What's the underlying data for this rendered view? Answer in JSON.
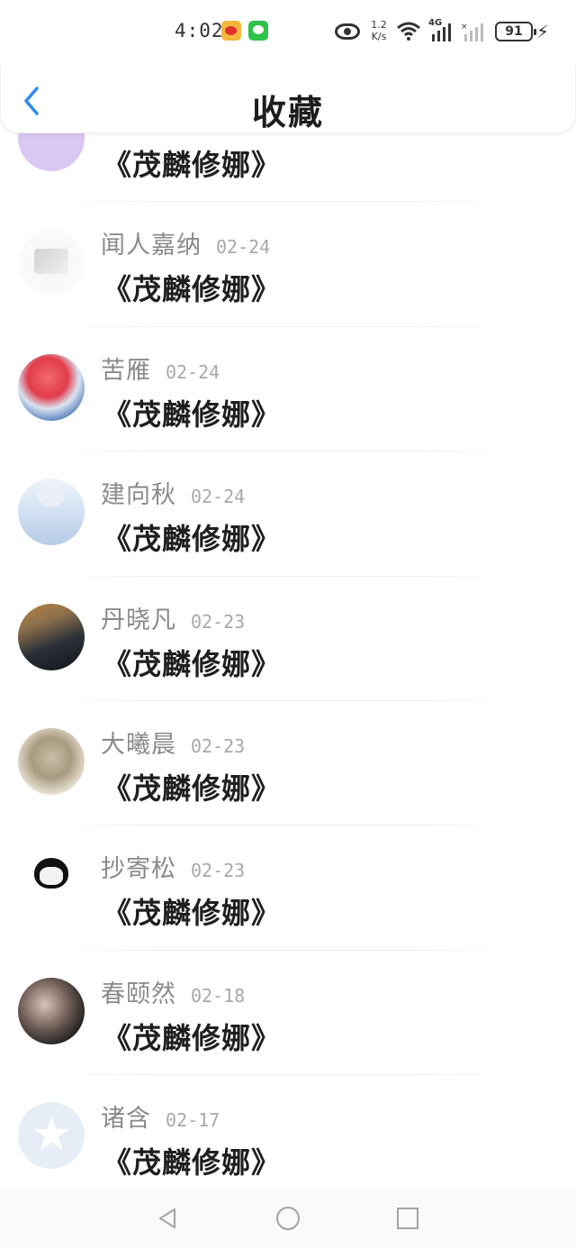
{
  "status_bar": {
    "time": "4:02",
    "net_speed_value": "1.2",
    "net_speed_unit": "K/s",
    "network_label": "4G",
    "battery": "91"
  },
  "header": {
    "title": "收藏"
  },
  "items": [
    {
      "name": "",
      "date": "",
      "content": "《茂麟修娜》"
    },
    {
      "name": "闻人嘉纳",
      "date": "02-24",
      "content": "《茂麟修娜》"
    },
    {
      "name": "苦雁",
      "date": "02-24",
      "content": "《茂麟修娜》"
    },
    {
      "name": "建向秋",
      "date": "02-24",
      "content": "《茂麟修娜》"
    },
    {
      "name": "丹晓凡",
      "date": "02-23",
      "content": "《茂麟修娜》"
    },
    {
      "name": "大曦晨",
      "date": "02-23",
      "content": "《茂麟修娜》"
    },
    {
      "name": "抄寄松",
      "date": "02-23",
      "content": "《茂麟修娜》"
    },
    {
      "name": "春颐然",
      "date": "02-18",
      "content": "《茂麟修娜》"
    },
    {
      "name": "诸含",
      "date": "02-17",
      "content": "《茂麟修娜》"
    }
  ],
  "colors": {
    "accent": "#2d8cf0",
    "name_gray": "#8a8a8a",
    "content_black": "#1f1f1f"
  }
}
